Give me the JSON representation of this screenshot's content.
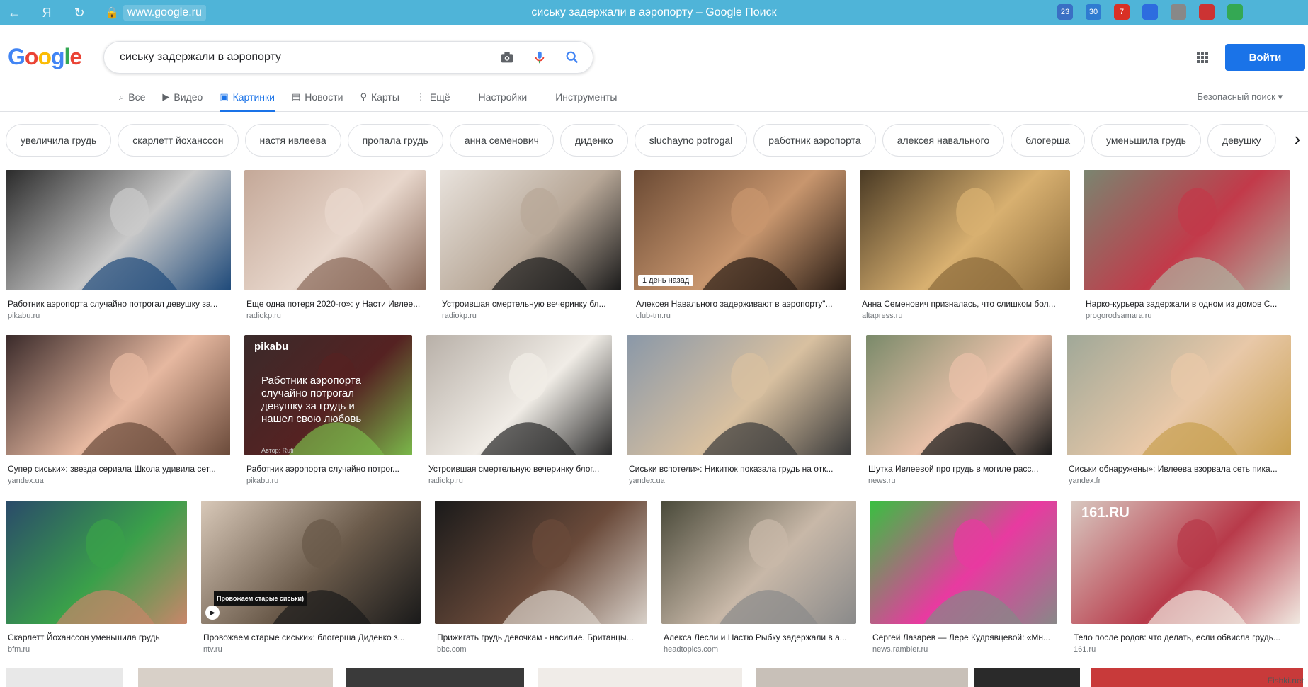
{
  "browser": {
    "url": "www.google.ru",
    "title": "сиську задержали в аэропорту – Google Поиск",
    "extensions": [
      {
        "label": "",
        "color": "#4fb4d8"
      },
      {
        "label": "",
        "color": "#4fb4d8"
      },
      {
        "label": "23",
        "color": "#3a6fc4"
      },
      {
        "label": "30",
        "color": "#2f7bd1"
      },
      {
        "label": "7",
        "color": "#d93025"
      },
      {
        "label": "",
        "color": "#2d6cdf"
      },
      {
        "label": "",
        "color": "#888888"
      },
      {
        "label": "",
        "color": "#cc3333"
      },
      {
        "label": "",
        "color": "#34a853"
      },
      {
        "label": "",
        "color": "#4fb4d8"
      },
      {
        "label": "",
        "color": "#4fb4d8"
      }
    ]
  },
  "search": {
    "query": "сиську задержали в аэропорту"
  },
  "header": {
    "login_label": "Войти",
    "safe_search": "Безопасный поиск ▾"
  },
  "tabs": [
    {
      "icon": "⌕",
      "label": "Все"
    },
    {
      "icon": "▶",
      "label": "Видео"
    },
    {
      "icon": "▣",
      "label": "Картинки",
      "active": true
    },
    {
      "icon": "▤",
      "label": "Новости"
    },
    {
      "icon": "⚲",
      "label": "Карты"
    },
    {
      "icon": "⋮",
      "label": "Ещё"
    }
  ],
  "tab_extras": [
    "Настройки",
    "Инструменты"
  ],
  "chips": [
    "увеличила грудь",
    "скарлетт йоханссон",
    "настя ивлеева",
    "пропала грудь",
    "анна семенович",
    "диденко",
    "sluchayno potrogal",
    "работник аэропорта",
    "алексея навального",
    "блогерша",
    "уменьшила грудь",
    "девушку"
  ],
  "results": [
    {
      "caption": "Работник аэропорта случайно потрогал девушку за...",
      "source": "pikabu.ru"
    },
    {
      "caption": "Еще одна потеря 2020-го»: у Насти Ивлее...",
      "source": "radiokp.ru"
    },
    {
      "caption": "Устроившая смертельную вечеринку бл...",
      "source": "radiokp.ru"
    },
    {
      "caption": "Алексея Навального задерживают в аэропорту\"...",
      "source": "club-tm.ru",
      "badge": "1 день назад"
    },
    {
      "caption": "Анна Семенович призналась, что слишком бол...",
      "source": "altapress.ru"
    },
    {
      "caption": "Нарко-курьера задержали в одном из домов С...",
      "source": "progorodsamara.ru"
    },
    {
      "caption": "Супер сиськи»: звезда сериала Школа удивила сет...",
      "source": "yandex.ua"
    },
    {
      "caption": "Работник аэропорта случайно потрог...",
      "source": "pikabu.ru",
      "inner_brand": "pikabu",
      "inner_text": "Работник аэропорта случайно потрогал девушку за грудь и нашел свою любовь",
      "inner_author": "Автор: Ruti"
    },
    {
      "caption": "Устроившая смертельную вечеринку блог...",
      "source": "radiokp.ru"
    },
    {
      "caption": "Сиськи вспотели»: Никитюк показала грудь на отк...",
      "source": "yandex.ua"
    },
    {
      "caption": "Шутка Ивлеевой про грудь в могиле расс...",
      "source": "news.ru"
    },
    {
      "caption": "Сиськи обнаружены»: Ивлеева взорвала сеть пика...",
      "source": "yandex.fr"
    },
    {
      "caption": "Скарлетт Йоханссон уменьшила грудь",
      "source": "bfm.ru"
    },
    {
      "caption": "Провожаем старые сиськи»: блогерша Диденко з...",
      "source": "ntv.ru",
      "inner_label": "Провожаем старые сиськи)"
    },
    {
      "caption": "Прижигать грудь девочкам - насилие. Британцы...",
      "source": "bbc.com"
    },
    {
      "caption": "Алекса Лесли и Настю Рыбку задержали в а...",
      "source": "headtopics.com"
    },
    {
      "caption": "Сергей Лазарев — Лере Кудрявцевой: «Мн...",
      "source": "news.rambler.ru"
    },
    {
      "caption": "Тело после родов: что делать, если обвисла грудь...",
      "source": "161.ru",
      "inner_brand": "161.RU"
    }
  ],
  "watermark": "Fishki.net"
}
